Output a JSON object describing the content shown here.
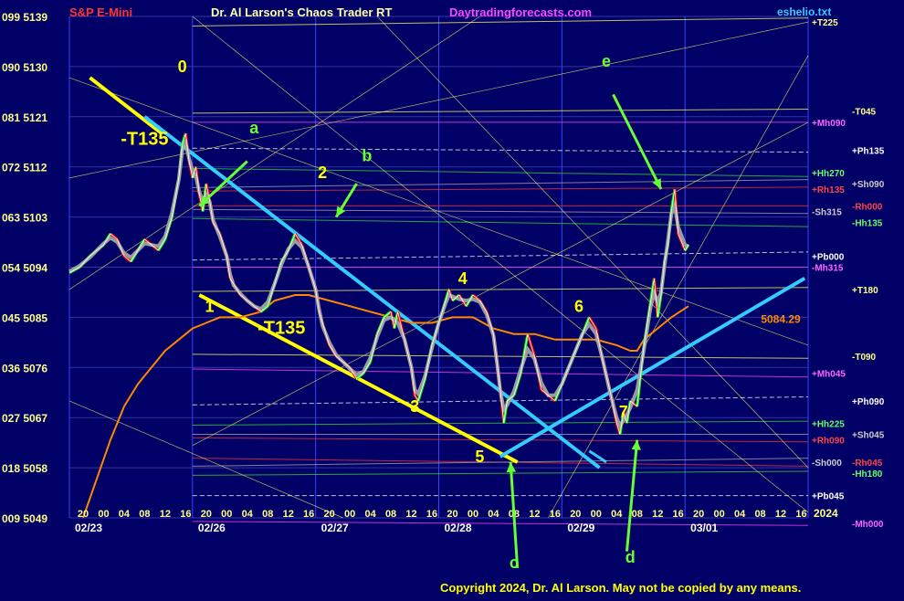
{
  "header": {
    "instrument": "S&P E-Mini",
    "title": "Dr. Al Larson's Chaos Trader RT",
    "site": "Daytradingforecasts.com",
    "file": "eshelio.txt"
  },
  "copyright": "Copyright 2024, Dr. Al Larson. May not be copied by any means.",
  "chart_data": {
    "type": "line",
    "ylim": [
      5049,
      5139
    ],
    "y_ticks": [
      {
        "value": 5139,
        "label": "099 5139"
      },
      {
        "value": 5130,
        "label": "090 5130"
      },
      {
        "value": 5121,
        "label": "081 5121"
      },
      {
        "value": 5112,
        "label": "072 5112"
      },
      {
        "value": 5103,
        "label": "063 5103"
      },
      {
        "value": 5094,
        "label": "054 5094"
      },
      {
        "value": 5085,
        "label": "045 5085"
      },
      {
        "value": 5076,
        "label": "036 5076"
      },
      {
        "value": 5067,
        "label": "027 5067"
      },
      {
        "value": 5058,
        "label": "018 5058"
      },
      {
        "value": 5049,
        "label": "009 5049"
      }
    ],
    "day_labels": [
      "02/23",
      "02/26",
      "02/27",
      "02/28",
      "02/29",
      "03/01"
    ],
    "hour_labels": [
      "20",
      "00",
      "04",
      "08",
      "12",
      "16"
    ],
    "year_label": "2024",
    "price_path": [
      [
        0,
        5093
      ],
      [
        3,
        5094
      ],
      [
        6,
        5096
      ],
      [
        8,
        5097
      ],
      [
        10,
        5098
      ],
      [
        12,
        5100
      ],
      [
        14,
        5099
      ],
      [
        16,
        5096
      ],
      [
        18,
        5095
      ],
      [
        20,
        5097
      ],
      [
        22,
        5099
      ],
      [
        24,
        5098
      ],
      [
        26,
        5097
      ],
      [
        28,
        5099
      ],
      [
        30,
        5103
      ],
      [
        32,
        5110
      ],
      [
        33,
        5116
      ],
      [
        34,
        5118
      ],
      [
        35,
        5113
      ],
      [
        36,
        5110
      ],
      [
        37,
        5112
      ],
      [
        38,
        5107
      ],
      [
        39,
        5104
      ],
      [
        40,
        5109
      ],
      [
        41,
        5106
      ],
      [
        42,
        5102
      ],
      [
        44,
        5100
      ],
      [
        46,
        5096
      ],
      [
        47,
        5092
      ],
      [
        48,
        5091
      ],
      [
        50,
        5089
      ],
      [
        52,
        5088
      ],
      [
        54,
        5087
      ],
      [
        56,
        5086
      ],
      [
        58,
        5087
      ],
      [
        60,
        5091
      ],
      [
        62,
        5095
      ],
      [
        64,
        5097
      ],
      [
        66,
        5100
      ],
      [
        68,
        5098
      ],
      [
        70,
        5094
      ],
      [
        72,
        5090
      ],
      [
        73,
        5086
      ],
      [
        74,
        5084
      ],
      [
        76,
        5080
      ],
      [
        78,
        5078
      ],
      [
        80,
        5077
      ],
      [
        82,
        5076
      ],
      [
        84,
        5074
      ],
      [
        86,
        5075
      ],
      [
        88,
        5077
      ],
      [
        90,
        5082
      ],
      [
        92,
        5085
      ],
      [
        94,
        5086
      ],
      [
        95,
        5083
      ],
      [
        96,
        5086
      ],
      [
        98,
        5081
      ],
      [
        100,
        5076
      ],
      [
        101,
        5071
      ],
      [
        102,
        5070
      ],
      [
        104,
        5074
      ],
      [
        106,
        5080
      ],
      [
        108,
        5084
      ],
      [
        110,
        5088
      ],
      [
        111,
        5090
      ],
      [
        112,
        5088
      ],
      [
        114,
        5089
      ],
      [
        116,
        5087
      ],
      [
        118,
        5089
      ],
      [
        120,
        5088
      ],
      [
        122,
        5086
      ],
      [
        124,
        5082
      ],
      [
        125,
        5077
      ],
      [
        126,
        5072
      ],
      [
        127,
        5066
      ],
      [
        128,
        5070
      ],
      [
        130,
        5071
      ],
      [
        132,
        5075
      ],
      [
        134,
        5082
      ],
      [
        136,
        5078
      ],
      [
        138,
        5072
      ],
      [
        140,
        5071
      ],
      [
        142,
        5070
      ],
      [
        144,
        5073
      ],
      [
        146,
        5076
      ],
      [
        148,
        5079
      ],
      [
        150,
        5082
      ],
      [
        152,
        5085
      ],
      [
        154,
        5083
      ],
      [
        156,
        5077
      ],
      [
        158,
        5072
      ],
      [
        160,
        5066
      ],
      [
        161,
        5064
      ],
      [
        162,
        5068
      ],
      [
        163,
        5066
      ],
      [
        164,
        5070
      ],
      [
        166,
        5069
      ],
      [
        168,
        5080
      ],
      [
        170,
        5088
      ],
      [
        171,
        5092
      ],
      [
        172,
        5085
      ],
      [
        173,
        5089
      ],
      [
        174,
        5095
      ],
      [
        175,
        5098
      ],
      [
        176,
        5104
      ],
      [
        177,
        5108
      ],
      [
        178,
        5100
      ],
      [
        180,
        5097
      ],
      [
        181,
        5098
      ]
    ],
    "price_range": [
      0,
      216
    ],
    "orange_ma": [
      [
        4,
        5049
      ],
      [
        8,
        5056
      ],
      [
        12,
        5063
      ],
      [
        16,
        5069
      ],
      [
        20,
        5073
      ],
      [
        24,
        5076
      ],
      [
        28,
        5079
      ],
      [
        32,
        5081
      ],
      [
        36,
        5083
      ],
      [
        40,
        5084
      ],
      [
        44,
        5085
      ],
      [
        50,
        5085
      ],
      [
        56,
        5086
      ],
      [
        60,
        5088
      ],
      [
        66,
        5089
      ],
      [
        70,
        5089
      ],
      [
        76,
        5088
      ],
      [
        82,
        5087
      ],
      [
        88,
        5086
      ],
      [
        94,
        5085
      ],
      [
        100,
        5084
      ],
      [
        106,
        5084
      ],
      [
        112,
        5085
      ],
      [
        118,
        5085
      ],
      [
        124,
        5083
      ],
      [
        130,
        5082
      ],
      [
        136,
        5082
      ],
      [
        142,
        5081
      ],
      [
        148,
        5081
      ],
      [
        154,
        5081
      ],
      [
        160,
        5080
      ],
      [
        164,
        5079
      ],
      [
        166,
        5079
      ],
      [
        168,
        5081
      ],
      [
        170,
        5082
      ],
      [
        172,
        5083
      ],
      [
        176,
        5085
      ],
      [
        181,
        5087
      ]
    ],
    "annotations": [
      {
        "text": "0",
        "color": "#ffff00",
        "x": 33,
        "y": 5129
      },
      {
        "text": "-T135",
        "color": "#ffff00",
        "x": 22,
        "y": 5116
      },
      {
        "text": "a",
        "color": "#66ff33",
        "x": 54,
        "y": 5118
      },
      {
        "text": "2",
        "color": "#ffff00",
        "x": 74,
        "y": 5110
      },
      {
        "text": "b",
        "color": "#66ff33",
        "x": 87,
        "y": 5113
      },
      {
        "text": "1",
        "color": "#ffff00",
        "x": 41,
        "y": 5086
      },
      {
        "text": "-T135",
        "color": "#ffff00",
        "x": 62,
        "y": 5082
      },
      {
        "text": "4",
        "color": "#ffff00",
        "x": 115,
        "y": 5091
      },
      {
        "text": "6",
        "color": "#ffff00",
        "x": 149,
        "y": 5086
      },
      {
        "text": "3",
        "color": "#ffff00",
        "x": 101,
        "y": 5068
      },
      {
        "text": "5",
        "color": "#ffff00",
        "x": 120,
        "y": 5059
      },
      {
        "text": "7",
        "color": "#ffff00",
        "x": 162,
        "y": 5067
      },
      {
        "text": "c",
        "color": "#66ff33",
        "x": 130,
        "y": 5040
      },
      {
        "text": "d",
        "color": "#66ff33",
        "x": 164,
        "y": 5041
      },
      {
        "text": "e",
        "color": "#66ff33",
        "x": 157,
        "y": 5130
      },
      {
        "text": "5084.29",
        "color": "#ff8800",
        "x": 208,
        "y": 5084
      }
    ],
    "right_labels": [
      {
        "text": "+T225",
        "color": "#ffff88",
        "y": 5138
      },
      {
        "text": "-T045",
        "color": "#ffff88",
        "y": 5122
      },
      {
        "text": "+Mh090",
        "color": "#ff66ff",
        "y": 5120
      },
      {
        "text": "+Ph135",
        "color": "#ffffff",
        "y": 5115
      },
      {
        "text": "+Hh270",
        "color": "#66ff66",
        "y": 5111
      },
      {
        "text": "+Sh090",
        "color": "#cccccc",
        "y": 5109
      },
      {
        "text": "+Rh135",
        "color": "#ff4444",
        "y": 5108
      },
      {
        "text": "-Rh000",
        "color": "#ff4444",
        "y": 5105
      },
      {
        "text": "-Sh315",
        "color": "#cccccc",
        "y": 5104
      },
      {
        "text": "-Hh135",
        "color": "#66ff66",
        "y": 5102
      },
      {
        "text": "+Pb000",
        "color": "#ffffff",
        "y": 5096
      },
      {
        "text": "+T180",
        "color": "#ffff88",
        "y": 5090
      },
      {
        "text": "-Mh315",
        "color": "#ff66ff",
        "y": 5094
      },
      {
        "text": "-T090",
        "color": "#ffff88",
        "y": 5078
      },
      {
        "text": "+Mh045",
        "color": "#ff66ff",
        "y": 5075
      },
      {
        "text": "+Ph090",
        "color": "#ffffff",
        "y": 5070
      },
      {
        "text": "+Hh225",
        "color": "#66ff66",
        "y": 5066
      },
      {
        "text": "+Sh045",
        "color": "#cccccc",
        "y": 5064
      },
      {
        "text": "+Rh090",
        "color": "#ff4444",
        "y": 5063
      },
      {
        "text": "-Rh045",
        "color": "#ff4444",
        "y": 5059
      },
      {
        "text": "-Sh000",
        "color": "#cccccc",
        "y": 5059
      },
      {
        "text": "-Hh180",
        "color": "#66ff66",
        "y": 5057
      },
      {
        "text": "+Pb045",
        "color": "#ffffff",
        "y": 5053
      },
      {
        "text": "-Mh000",
        "color": "#ff66ff",
        "y": 5048
      }
    ]
  },
  "colors": {
    "background": "#000066",
    "price_up": "#00ff00",
    "price_down": "#ff0000",
    "smooth": "#aaaaaa",
    "ma": "#ff8800",
    "trend_yellow": "#ffff00",
    "trend_cyan": "#33ccff",
    "arrow_green": "#66ff33",
    "tick_text": "#ffff88",
    "date_text": "#ffffff"
  }
}
